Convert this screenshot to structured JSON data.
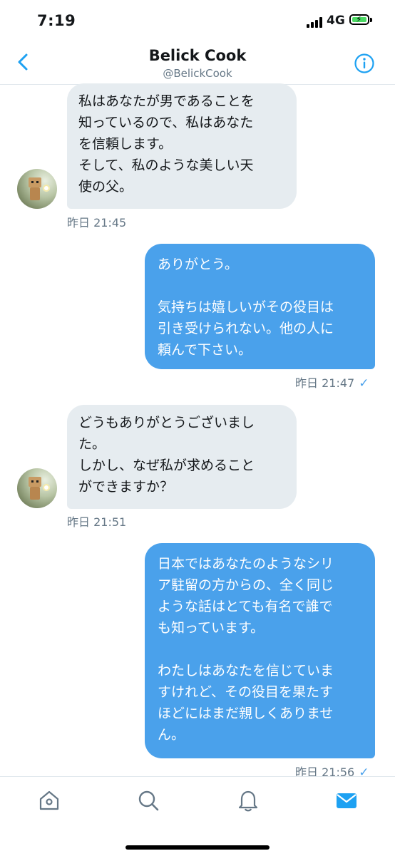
{
  "status_bar": {
    "time": "7:19",
    "network": "4G"
  },
  "header": {
    "title": "Belick Cook",
    "handle": "@BelickCook"
  },
  "messages": [
    {
      "direction": "incoming",
      "text": "私はあなたが男であることを\n知っているので、私はあなた\nを信頼します。\nそして、私のような美しい天\n使の父。",
      "time": "昨日 21:45"
    },
    {
      "direction": "outgoing",
      "text": "ありがとう。\n\n気持ちは嬉しいがその役目は\n引き受けられない。他の人に\n頼んで下さい。",
      "time": "昨日 21:47",
      "read": "✓"
    },
    {
      "direction": "incoming",
      "text": "どうもありがとうございまし\nた。\nしかし、なぜ私が求めること\nができますか？",
      "time": "昨日 21:51"
    },
    {
      "direction": "outgoing",
      "text": "日本ではあなたのようなシリ\nア駐留の方からの、全く同じ\nような話はとても有名で誰で\nも知っています。\n\nわたしはあなたを信じていま\nすけれど、その役目を果たす\nほどにはまだ親しくありませ\nん。",
      "time": "昨日 21:56",
      "read": "✓"
    }
  ],
  "tabbar": {
    "items": [
      "home-icon",
      "search-icon",
      "notifications-icon",
      "messages-icon"
    ],
    "active": "messages-icon"
  },
  "colors": {
    "accent": "#1da1f2",
    "outgoing_bubble": "#4aa1eb",
    "incoming_bubble": "#e6ecf0",
    "timestamp": "#657786"
  }
}
